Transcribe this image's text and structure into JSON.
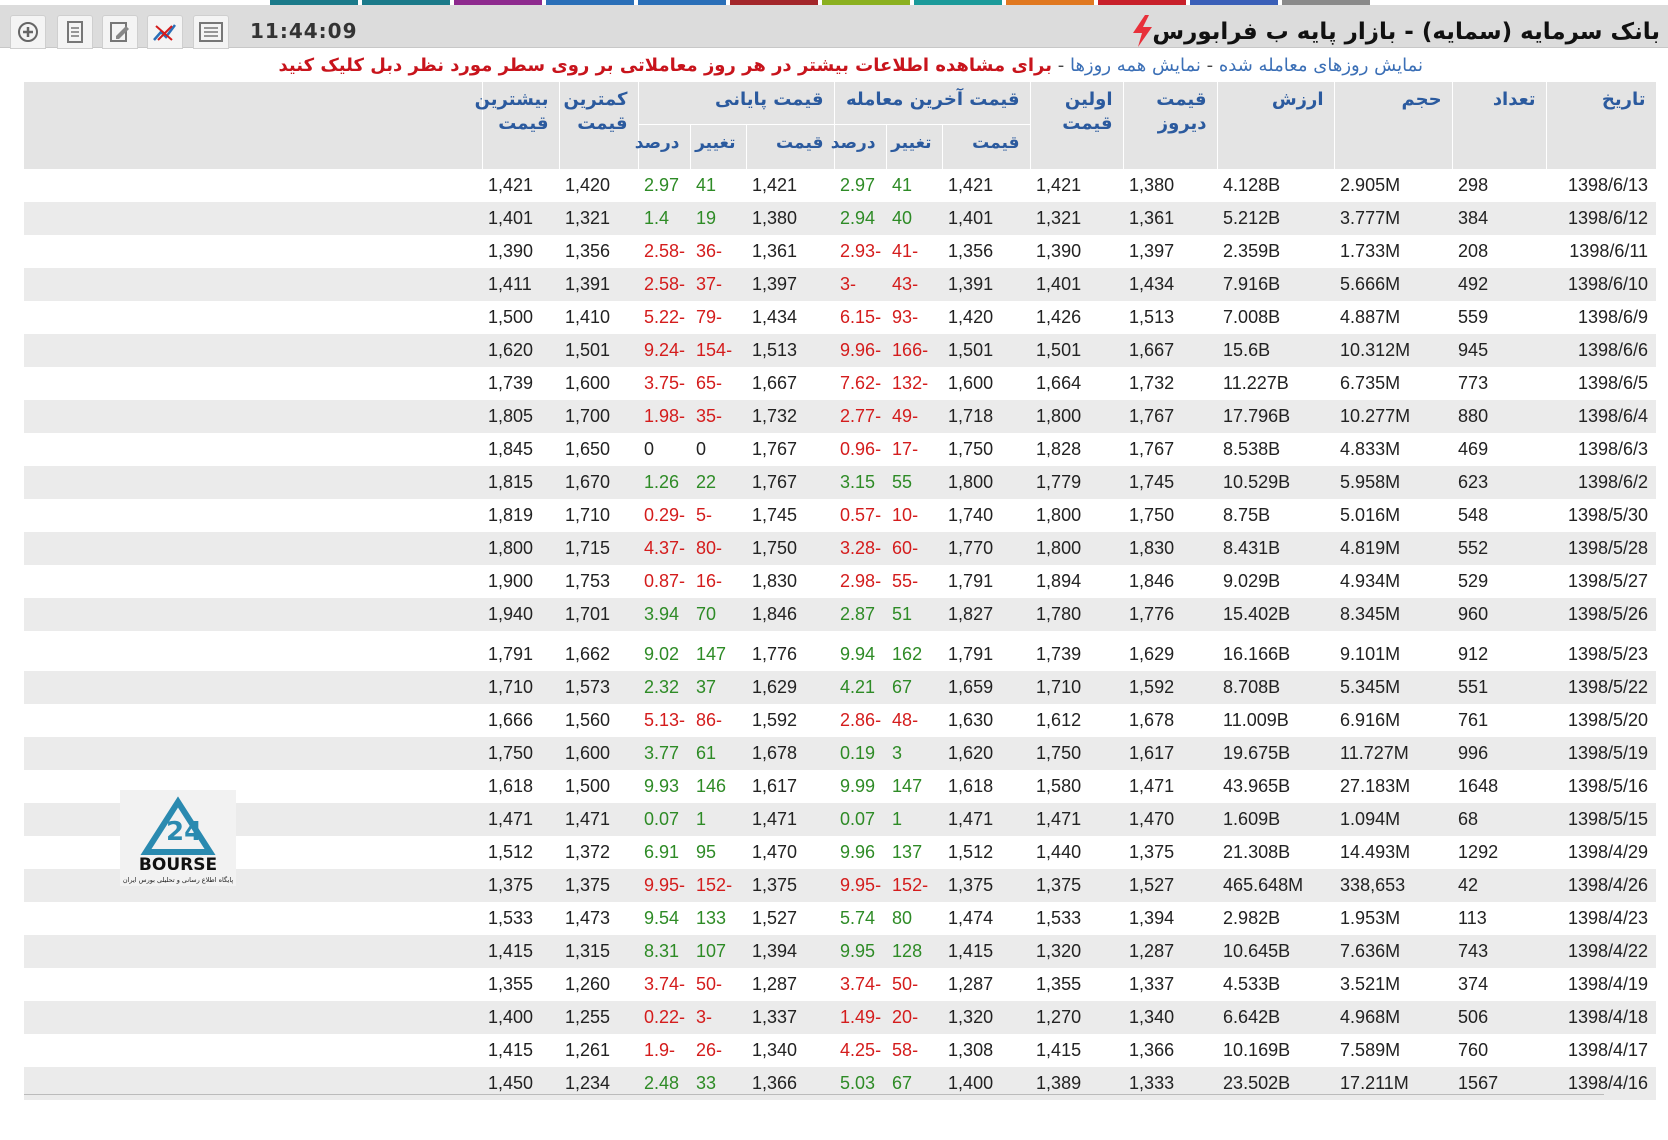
{
  "toolbar": {
    "time": "11:44:09",
    "title": "بانک سرمایه (سمایه) - بازار پایه ب فرابورس",
    "tab_colors": [
      "#1b7a8a",
      "#1b7a8a",
      "#8e2a8e",
      "#2a6fb8",
      "#2a6fb8",
      "#a3262a",
      "#8bb020",
      "#1b9a9a",
      "#e07820",
      "#c8202a",
      "#3a5fb8",
      "#8a8a8a"
    ]
  },
  "info": {
    "link_traded": "نمایش روزهای معامله شده",
    "link_all": "نمایش همه روزها",
    "sep": " - ",
    "note": "برای مشاهده اطلاعات بیشتر در هر روز معاملاتی بر روی سطر مورد نظر دبل کلیک کنید"
  },
  "headers": {
    "date": "تاریخ",
    "count": "تعداد",
    "volume": "حجم",
    "value": "ارزش",
    "prev_line1": "قیمت",
    "prev_line2": "دیروز",
    "first_line1": "اولین",
    "first_line2": "قیمت",
    "last_group": "قیمت آخرین معامله",
    "close_group": "قیمت پایانی",
    "price": "قیمت",
    "change": "تغییر",
    "percent": "درصد",
    "min_line1": "کمترین",
    "min_line2": "قیمت",
    "max_line1": "بیشترین",
    "max_line2": "قیمت"
  },
  "rows": [
    [
      "1398/6/13",
      "298",
      "2.905M",
      "4.128B",
      "1,380",
      "1,421",
      "1,421",
      "41",
      "2.97",
      "1,421",
      "41",
      "2.97",
      "1,420",
      "1,421"
    ],
    [
      "1398/6/12",
      "384",
      "3.777M",
      "5.212B",
      "1,361",
      "1,321",
      "1,401",
      "40",
      "2.94",
      "1,380",
      "19",
      "1.4",
      "1,321",
      "1,401"
    ],
    [
      "1398/6/11",
      "208",
      "1.733M",
      "2.359B",
      "1,397",
      "1,390",
      "1,356",
      "-41",
      "-2.93",
      "1,361",
      "-36",
      "-2.58",
      "1,356",
      "1,390"
    ],
    [
      "1398/6/10",
      "492",
      "5.666M",
      "7.916B",
      "1,434",
      "1,401",
      "1,391",
      "-43",
      "-3",
      "1,397",
      "-37",
      "-2.58",
      "1,391",
      "1,411"
    ],
    [
      "1398/6/9",
      "559",
      "4.887M",
      "7.008B",
      "1,513",
      "1,426",
      "1,420",
      "-93",
      "-6.15",
      "1,434",
      "-79",
      "-5.22",
      "1,410",
      "1,500"
    ],
    [
      "1398/6/6",
      "945",
      "10.312M",
      "15.6B",
      "1,667",
      "1,501",
      "1,501",
      "-166",
      "-9.96",
      "1,513",
      "-154",
      "-9.24",
      "1,501",
      "1,620"
    ],
    [
      "1398/6/5",
      "773",
      "6.735M",
      "11.227B",
      "1,732",
      "1,664",
      "1,600",
      "-132",
      "-7.62",
      "1,667",
      "-65",
      "-3.75",
      "1,600",
      "1,739"
    ],
    [
      "1398/6/4",
      "880",
      "10.277M",
      "17.796B",
      "1,767",
      "1,800",
      "1,718",
      "-49",
      "-2.77",
      "1,732",
      "-35",
      "-1.98",
      "1,700",
      "1,805"
    ],
    [
      "1398/6/3",
      "469",
      "4.833M",
      "8.538B",
      "1,767",
      "1,828",
      "1,750",
      "-17",
      "-0.96",
      "1,767",
      "0",
      "0",
      "1,650",
      "1,845"
    ],
    [
      "1398/6/2",
      "623",
      "5.958M",
      "10.529B",
      "1,745",
      "1,779",
      "1,800",
      "55",
      "3.15",
      "1,767",
      "22",
      "1.26",
      "1,670",
      "1,815"
    ],
    [
      "1398/5/30",
      "548",
      "5.016M",
      "8.75B",
      "1,750",
      "1,800",
      "1,740",
      "-10",
      "-0.57",
      "1,745",
      "-5",
      "-0.29",
      "1,710",
      "1,819"
    ],
    [
      "1398/5/28",
      "552",
      "4.819M",
      "8.431B",
      "1,830",
      "1,800",
      "1,770",
      "-60",
      "-3.28",
      "1,750",
      "-80",
      "-4.37",
      "1,715",
      "1,800"
    ],
    [
      "1398/5/27",
      "529",
      "4.934M",
      "9.029B",
      "1,846",
      "1,894",
      "1,791",
      "-55",
      "-2.98",
      "1,830",
      "-16",
      "-0.87",
      "1,753",
      "1,900"
    ],
    [
      "1398/5/26",
      "960",
      "8.345M",
      "15.402B",
      "1,776",
      "1,780",
      "1,827",
      "51",
      "2.87",
      "1,846",
      "70",
      "3.94",
      "1,701",
      "1,940"
    ],
    [
      "1398/5/23",
      "912",
      "9.101M",
      "16.166B",
      "1,629",
      "1,739",
      "1,791",
      "162",
      "9.94",
      "1,776",
      "147",
      "9.02",
      "1,662",
      "1,791"
    ],
    [
      "1398/5/22",
      "551",
      "5.345M",
      "8.708B",
      "1,592",
      "1,710",
      "1,659",
      "67",
      "4.21",
      "1,629",
      "37",
      "2.32",
      "1,573",
      "1,710"
    ],
    [
      "1398/5/20",
      "761",
      "6.916M",
      "11.009B",
      "1,678",
      "1,612",
      "1,630",
      "-48",
      "-2.86",
      "1,592",
      "-86",
      "-5.13",
      "1,560",
      "1,666"
    ],
    [
      "1398/5/19",
      "996",
      "11.727M",
      "19.675B",
      "1,617",
      "1,750",
      "1,620",
      "3",
      "0.19",
      "1,678",
      "61",
      "3.77",
      "1,600",
      "1,750"
    ],
    [
      "1398/5/16",
      "1648",
      "27.183M",
      "43.965B",
      "1,471",
      "1,580",
      "1,618",
      "147",
      "9.99",
      "1,617",
      "146",
      "9.93",
      "1,500",
      "1,618"
    ],
    [
      "1398/5/15",
      "68",
      "1.094M",
      "1.609B",
      "1,470",
      "1,471",
      "1,471",
      "1",
      "0.07",
      "1,471",
      "1",
      "0.07",
      "1,471",
      "1,471"
    ],
    [
      "1398/4/29",
      "1292",
      "14.493M",
      "21.308B",
      "1,375",
      "1,440",
      "1,512",
      "137",
      "9.96",
      "1,470",
      "95",
      "6.91",
      "1,372",
      "1,512"
    ],
    [
      "1398/4/26",
      "42",
      "338,653",
      "465.648M",
      "1,527",
      "1,375",
      "1,375",
      "-152",
      "-9.95",
      "1,375",
      "-152",
      "-9.95",
      "1,375",
      "1,375"
    ],
    [
      "1398/4/23",
      "113",
      "1.953M",
      "2.982B",
      "1,394",
      "1,533",
      "1,474",
      "80",
      "5.74",
      "1,527",
      "133",
      "9.54",
      "1,473",
      "1,533"
    ],
    [
      "1398/4/22",
      "743",
      "7.636M",
      "10.645B",
      "1,287",
      "1,320",
      "1,415",
      "128",
      "9.95",
      "1,394",
      "107",
      "8.31",
      "1,315",
      "1,415"
    ],
    [
      "1398/4/19",
      "374",
      "3.521M",
      "4.533B",
      "1,337",
      "1,355",
      "1,287",
      "-50",
      "-3.74",
      "1,287",
      "-50",
      "-3.74",
      "1,260",
      "1,355"
    ],
    [
      "1398/4/18",
      "506",
      "4.968M",
      "6.642B",
      "1,340",
      "1,270",
      "1,320",
      "-20",
      "-1.49",
      "1,337",
      "-3",
      "-0.22",
      "1,255",
      "1,400"
    ],
    [
      "1398/4/17",
      "760",
      "7.589M",
      "10.169B",
      "1,366",
      "1,415",
      "1,308",
      "-58",
      "-4.25",
      "1,340",
      "-26",
      "-1.9",
      "1,261",
      "1,415"
    ],
    [
      "1398/4/16",
      "1567",
      "17.211M",
      "23.502B",
      "1,333",
      "1,389",
      "1,400",
      "67",
      "5.03",
      "1,366",
      "33",
      "2.48",
      "1,234",
      "1,450"
    ]
  ],
  "logo": {
    "number": "24",
    "word": "BOURSE",
    "tagline": "پایگاه اطلاع رسانی و تحلیلی بورس ایران"
  },
  "colors": {
    "header_text": "#2b5a9e",
    "positive": "#2e8b26",
    "negative": "#d41c1c",
    "note": "#c8141c",
    "logo": "#2a8ab0"
  }
}
